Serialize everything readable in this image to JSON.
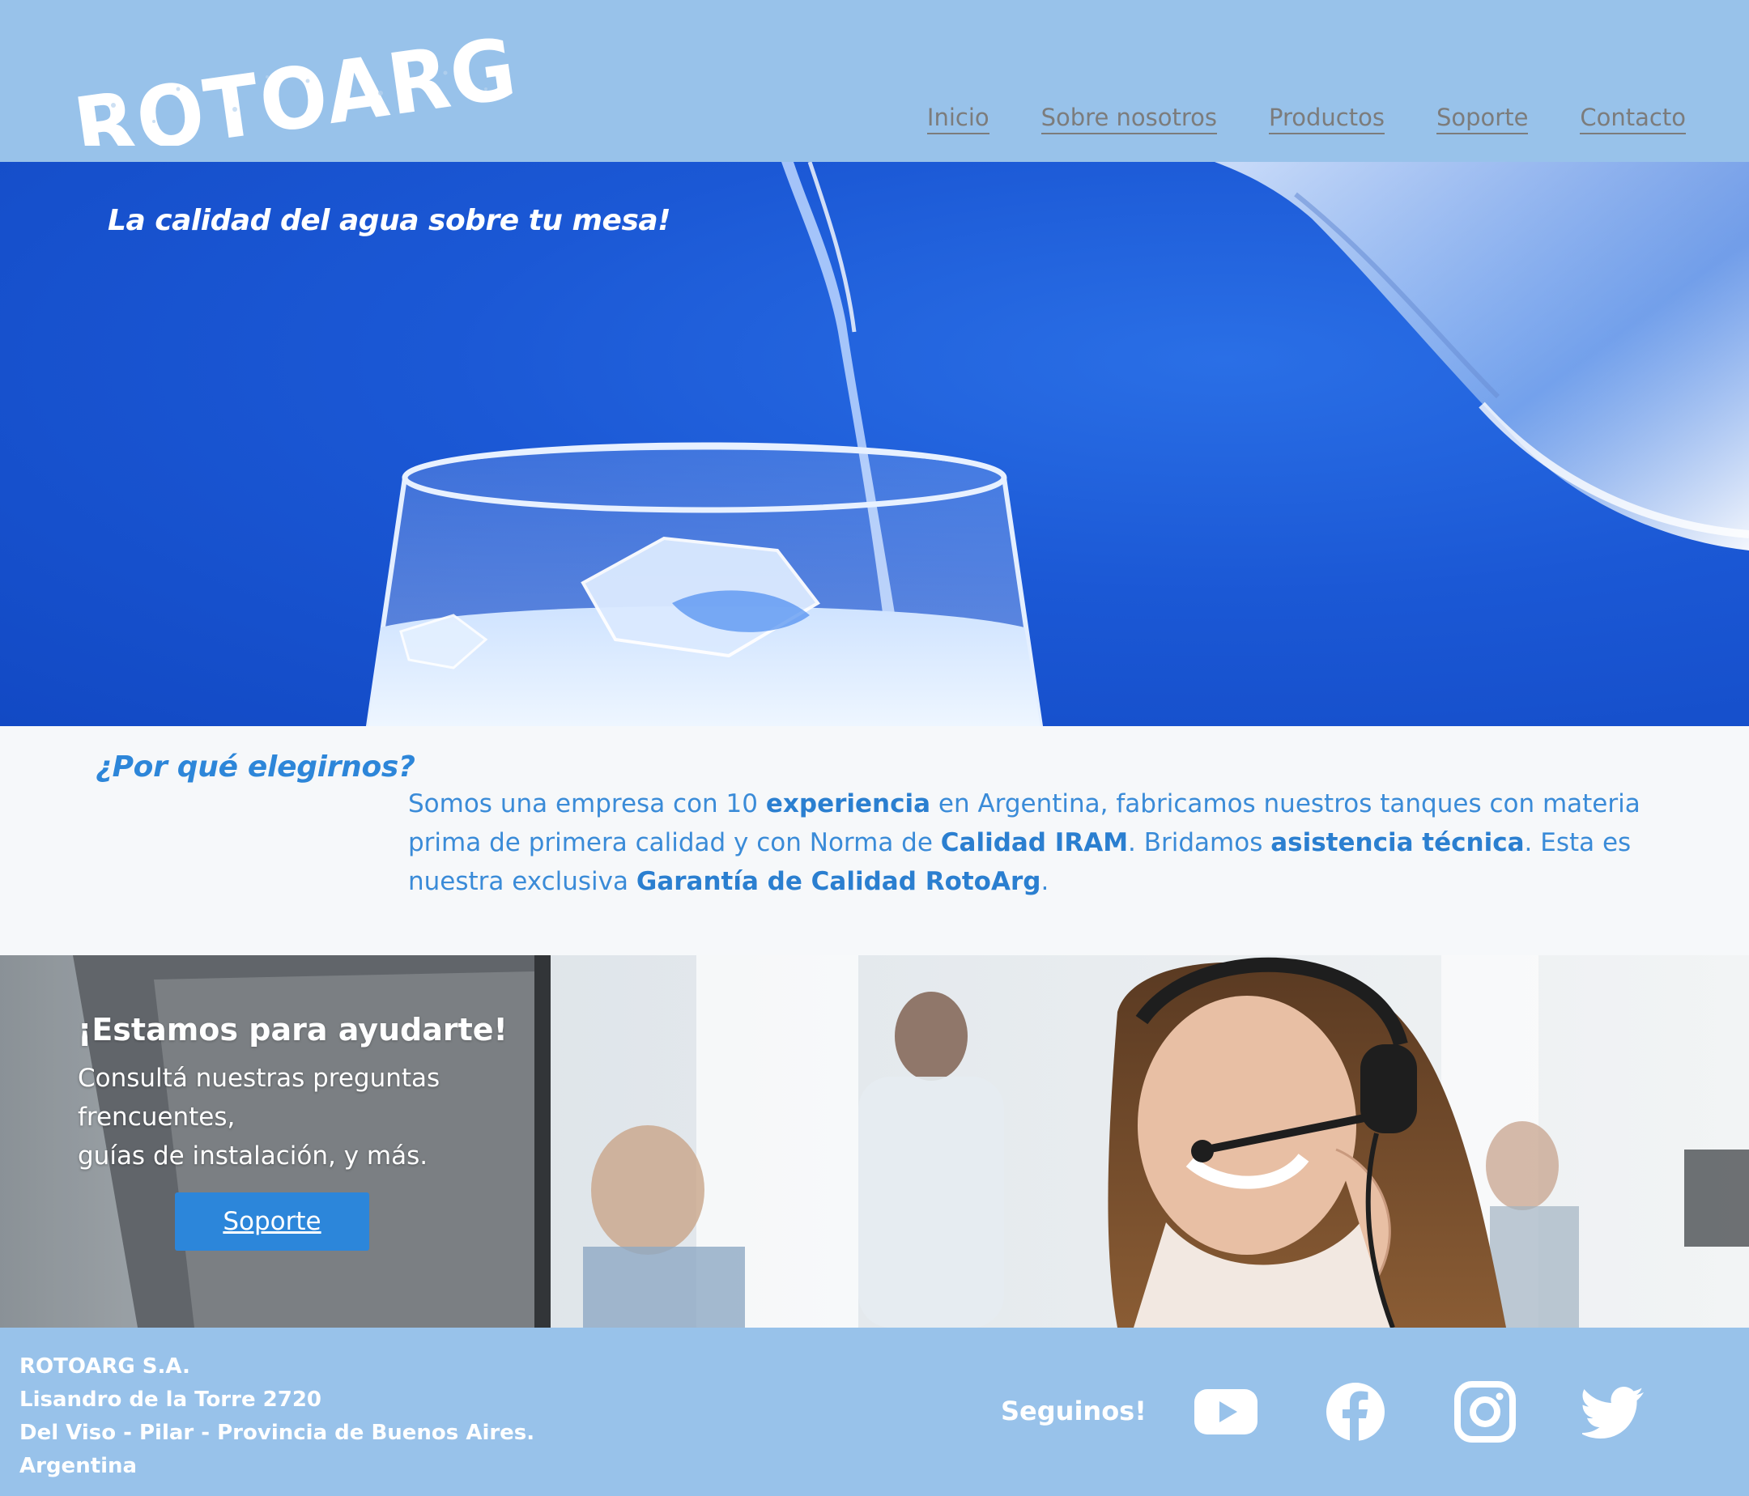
{
  "header": {
    "logo_text": "ROTOARG",
    "nav": [
      {
        "label": "Inicio"
      },
      {
        "label": "Sobre nosotros"
      },
      {
        "label": "Productos"
      },
      {
        "label": "Soporte"
      },
      {
        "label": "Contacto"
      }
    ]
  },
  "hero": {
    "tagline": "La calidad del agua sobre tu mesa!"
  },
  "why": {
    "title": "¿Por qué elegirnos?",
    "t1": "Somos una empresa con 10 ",
    "b1": "experiencia",
    "t2": " en Argentina, fabricamos nuestros tanques con materia prima de primera calidad y con Norma de ",
    "b2": "Calidad IRAM",
    "t3": ". Bridamos ",
    "b3": "asistencia técnica",
    "t4": ". Esta es nuestra exclusiva ",
    "b4": "Garantía de Calidad RotoArg",
    "t5": "."
  },
  "support": {
    "title": "¡Estamos para ayudarte!",
    "line1": "Consultá nuestras preguntas",
    "line2": "frencuentes,",
    "line3": "guías de instalación, y más.",
    "button": "Soporte"
  },
  "footer": {
    "company": "ROTOARG S.A.",
    "street": "Lisandro de la Torre 2720",
    "city": "Del Viso - Pilar - Provincia de Buenos Aires.",
    "country": "Argentina",
    "follow": "Seguinos!",
    "social": [
      "youtube-icon",
      "facebook-icon",
      "instagram-icon",
      "twitter-icon"
    ]
  },
  "colors": {
    "header_bg": "#98c2ea",
    "accent_blue": "#2c86da",
    "hero_blue": "#1b58d5",
    "nav_text": "#7c7c7c"
  }
}
